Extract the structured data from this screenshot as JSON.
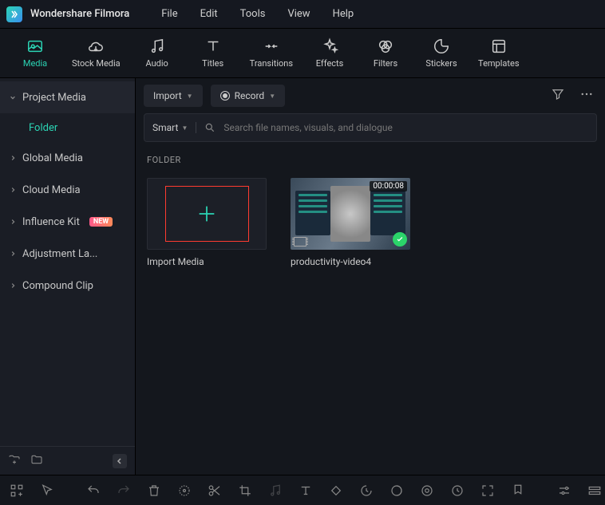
{
  "app_title": "Wondershare Filmora",
  "menu": {
    "file": "File",
    "edit": "Edit",
    "tools": "Tools",
    "view": "View",
    "help": "Help"
  },
  "tabs": {
    "media": "Media",
    "stock": "Stock Media",
    "audio": "Audio",
    "titles": "Titles",
    "transitions": "Transitions",
    "effects": "Effects",
    "filters": "Filters",
    "stickers": "Stickers",
    "templates": "Templates"
  },
  "sidebar": {
    "project_media": "Project Media",
    "folder": "Folder",
    "global_media": "Global Media",
    "cloud_media": "Cloud Media",
    "influence_kit": "Influence Kit",
    "influence_badge": "NEW",
    "adjustment": "Adjustment La...",
    "compound": "Compound Clip"
  },
  "controls": {
    "import": "Import",
    "record": "Record",
    "smart": "Smart",
    "search_placeholder": "Search file names, visuals, and dialogue"
  },
  "section": "FOLDER",
  "cards": {
    "import": "Import Media",
    "video1": "productivity-video4",
    "video1_duration": "00:00:08"
  }
}
